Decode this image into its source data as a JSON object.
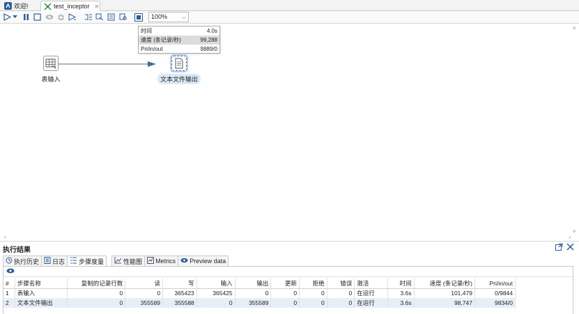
{
  "tabs": [
    {
      "label": "欢迎!",
      "active": false
    },
    {
      "label": "test_inceptor",
      "active": true
    }
  ],
  "toolbar": {
    "zoom": "100%"
  },
  "canvas": {
    "steps": [
      {
        "label": "表输入",
        "icon": "table-input-icon",
        "selected": false
      },
      {
        "label": "文本文件输出",
        "icon": "text-file-output-icon",
        "selected": true
      }
    ],
    "tooltip": {
      "rows": [
        {
          "key": "时间",
          "value": "4.0s"
        },
        {
          "key": "速度 (条记录/秒)",
          "value": "99,288"
        },
        {
          "key": "Pri/in/out",
          "value": "9889/0"
        }
      ]
    }
  },
  "results": {
    "title": "执行结果",
    "tabs": [
      {
        "label": "执行历史",
        "icon": "history-icon"
      },
      {
        "label": "日志",
        "icon": "log-icon"
      },
      {
        "label": "步骤度量",
        "icon": "step-metrics-icon"
      },
      {
        "label": "性能图",
        "icon": "performance-chart-icon"
      },
      {
        "label": "Metrics",
        "icon": "metrics-icon"
      },
      {
        "label": "Preview data",
        "icon": "preview-eye-icon"
      }
    ],
    "columns": [
      "#",
      "步骤名称",
      "复制的记录行数",
      "读",
      "写",
      "输入",
      "输出",
      "更新",
      "拒绝",
      "错误",
      "激活",
      "时间",
      "速度 (条记录/秒)",
      "Pri/in/out"
    ],
    "rows": [
      [
        "1",
        "表输入",
        "0",
        "0",
        "365423",
        "365425",
        "0",
        "0",
        "0",
        "0",
        "在运行",
        "3.6s",
        "101,479",
        "0/9844"
      ],
      [
        "2",
        "文本文件输出",
        "0",
        "355589",
        "355588",
        "0",
        "355589",
        "0",
        "0",
        "0",
        "在运行",
        "3.6s",
        "98,747",
        "9834/0"
      ]
    ]
  },
  "colors": {
    "accent": "#2b5d9b",
    "selection": "#dce8f5",
    "row_highlight": "#e8eef8"
  }
}
